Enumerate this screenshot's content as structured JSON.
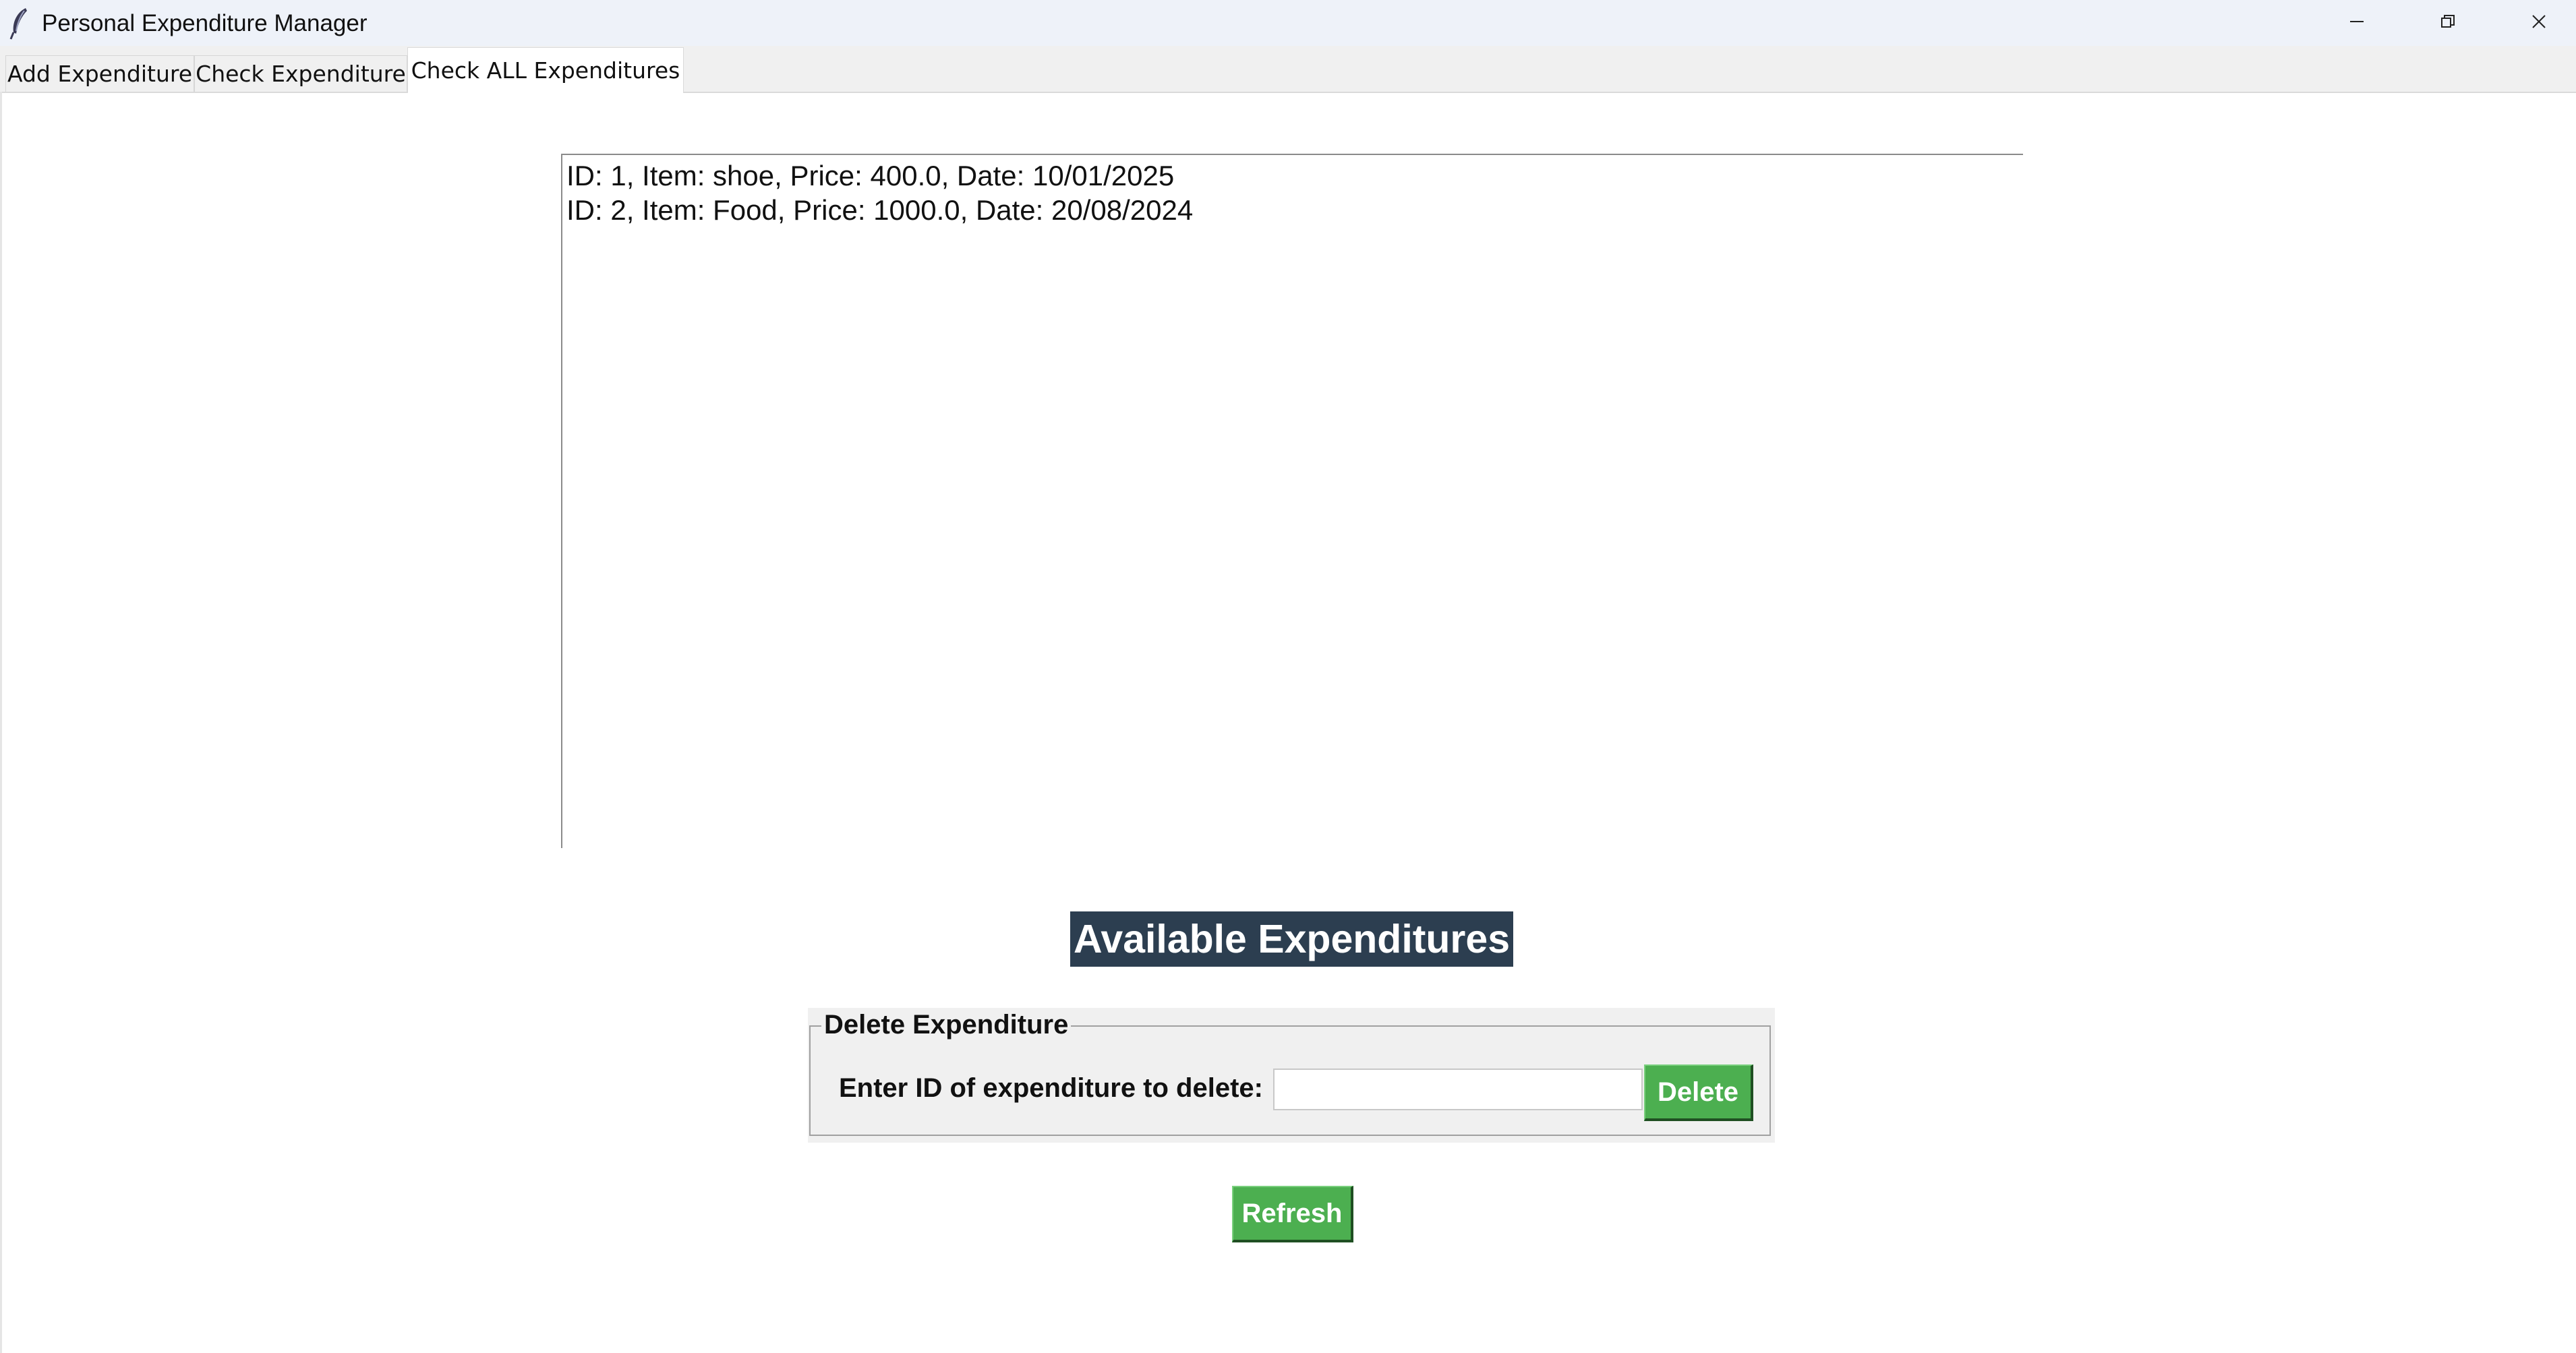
{
  "window": {
    "title": "Personal Expenditure Manager",
    "icon": "feather-icon",
    "controls": [
      "minimize-icon",
      "maximize-icon",
      "close-icon"
    ]
  },
  "tabs": [
    {
      "label": "Add Expenditure",
      "active": false
    },
    {
      "label": "Check Expenditure",
      "active": false
    },
    {
      "label": "Check ALL Expenditures",
      "active": true
    }
  ],
  "expenditures": [
    "ID: 1, Item: shoe, Price: 400.0, Date: 10/01/2025",
    "ID: 2, Item: Food, Price: 1000.0, Date: 20/08/2024"
  ],
  "heading": "Available Expenditures",
  "delete_group": {
    "legend": "Delete Expenditure",
    "label": "Enter ID of expenditure to delete:",
    "input_value": "",
    "button_label": "Delete"
  },
  "refresh_label": "Refresh",
  "colors": {
    "heading_bg": "#2c3e50",
    "button_green": "#4caf50"
  }
}
